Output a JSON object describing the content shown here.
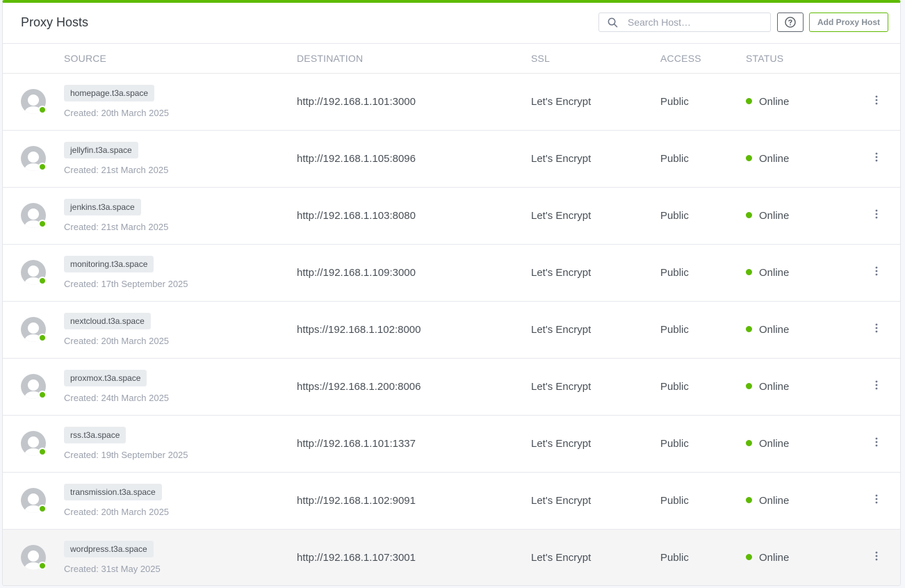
{
  "header": {
    "title": "Proxy Hosts",
    "search_placeholder": "Search Host…",
    "add_button": "Add Proxy Host"
  },
  "columns": [
    "SOURCE",
    "DESTINATION",
    "SSL",
    "ACCESS",
    "STATUS"
  ],
  "colors": {
    "accent": "#5eba00",
    "online": "#5eba00"
  },
  "rows": [
    {
      "domain": "homepage.t3a.space",
      "created": "Created: 20th March 2025",
      "destination": "http://192.168.1.101:3000",
      "ssl": "Let's Encrypt",
      "access": "Public",
      "status": "Online"
    },
    {
      "domain": "jellyfin.t3a.space",
      "created": "Created: 21st March 2025",
      "destination": "http://192.168.1.105:8096",
      "ssl": "Let's Encrypt",
      "access": "Public",
      "status": "Online"
    },
    {
      "domain": "jenkins.t3a.space",
      "created": "Created: 21st March 2025",
      "destination": "http://192.168.1.103:8080",
      "ssl": "Let's Encrypt",
      "access": "Public",
      "status": "Online"
    },
    {
      "domain": "monitoring.t3a.space",
      "created": "Created: 17th September 2025",
      "destination": "http://192.168.1.109:3000",
      "ssl": "Let's Encrypt",
      "access": "Public",
      "status": "Online"
    },
    {
      "domain": "nextcloud.t3a.space",
      "created": "Created: 20th March 2025",
      "destination": "https://192.168.1.102:8000",
      "ssl": "Let's Encrypt",
      "access": "Public",
      "status": "Online"
    },
    {
      "domain": "proxmox.t3a.space",
      "created": "Created: 24th March 2025",
      "destination": "https://192.168.1.200:8006",
      "ssl": "Let's Encrypt",
      "access": "Public",
      "status": "Online"
    },
    {
      "domain": "rss.t3a.space",
      "created": "Created: 19th September 2025",
      "destination": "http://192.168.1.101:1337",
      "ssl": "Let's Encrypt",
      "access": "Public",
      "status": "Online"
    },
    {
      "domain": "transmission.t3a.space",
      "created": "Created: 20th March 2025",
      "destination": "http://192.168.1.102:9091",
      "ssl": "Let's Encrypt",
      "access": "Public",
      "status": "Online"
    },
    {
      "domain": "wordpress.t3a.space",
      "created": "Created: 31st May 2025",
      "destination": "http://192.168.1.107:3001",
      "ssl": "Let's Encrypt",
      "access": "Public",
      "status": "Online"
    }
  ]
}
